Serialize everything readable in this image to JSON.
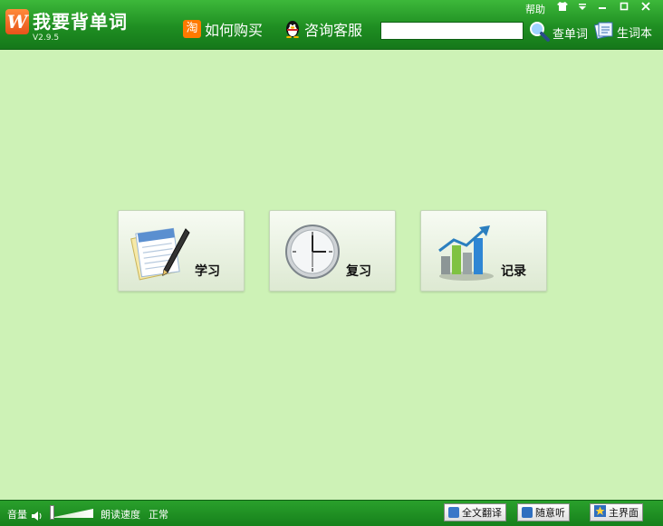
{
  "app": {
    "title": "我要背单词",
    "version": "V2.9.5",
    "logo_letter": "W"
  },
  "header": {
    "buy_label": "如何购买",
    "taobao_glyph": "淘",
    "support_label": "咨询客服",
    "search_value": "",
    "lookup_label": "查单词",
    "vocab_label": "生词本",
    "help_label": "帮助"
  },
  "main": {
    "cards": [
      {
        "label": "学习",
        "icon": "notepad-pen-icon"
      },
      {
        "label": "复习",
        "icon": "clock-icon"
      },
      {
        "label": "记录",
        "icon": "bar-chart-icon"
      }
    ]
  },
  "footer": {
    "volume_label": "音量",
    "speed_label": "朗读速度",
    "speed_value": "正常",
    "translate_label": "全文翻译",
    "listen_label": "随意听",
    "home_label": "主界面"
  },
  "colors": {
    "accent": "#1f8e22",
    "background": "#cdf2b6",
    "brand_orange": "#e8531a"
  }
}
